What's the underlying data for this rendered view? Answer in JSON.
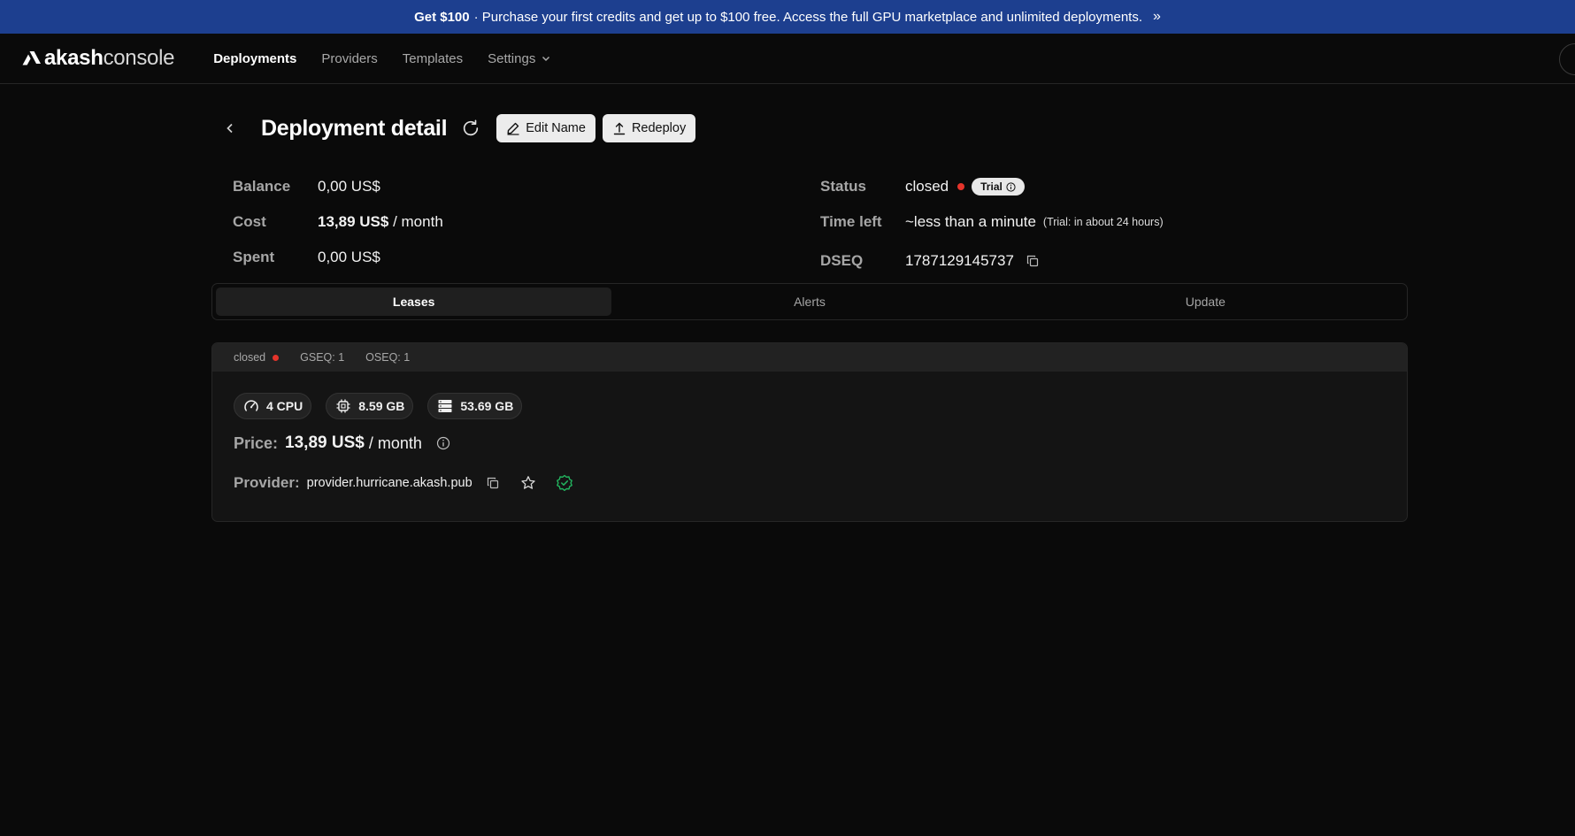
{
  "banner": {
    "bold": "Get $100",
    "text": "· Purchase your first credits and get up to $100 free. Access the full GPU marketplace and unlimited deployments.",
    "chevron": "»"
  },
  "nav": {
    "logo_bold": "akash",
    "logo_light": "console",
    "links": [
      "Deployments",
      "Providers",
      "Templates",
      "Settings"
    ]
  },
  "header": {
    "title": "Deployment detail",
    "edit_name_label": "Edit Name",
    "redeploy_label": "Redeploy"
  },
  "stats": {
    "balance_label": "Balance",
    "balance_value": "0,00 US$",
    "cost_label": "Cost",
    "cost_value": "13,89 US$",
    "cost_unit": "/ month",
    "spent_label": "Spent",
    "spent_value": "0,00 US$",
    "status_label": "Status",
    "status_value": "closed",
    "trial_label": "Trial",
    "time_left_label": "Time left",
    "time_left_value": "~less than a minute",
    "time_left_note": "(Trial: in about 24 hours)",
    "dseq_label": "DSEQ",
    "dseq_value": "1787129145737"
  },
  "tabs": [
    "Leases",
    "Alerts",
    "Update"
  ],
  "lease": {
    "status": "closed",
    "gseq": "GSEQ: 1",
    "oseq": "OSEQ: 1",
    "cpu": "4 CPU",
    "memory": "8.59 GB",
    "storage": "53.69 GB",
    "price_label": "Price:",
    "price_value": "13,89 US$",
    "price_unit": "/ month",
    "provider_label": "Provider:",
    "provider_name": "provider.hurricane.akash.pub"
  },
  "colors": {
    "banner_bg": "#1d3f8f",
    "status_red": "#e5342b",
    "audited_green": "#22b35e"
  }
}
